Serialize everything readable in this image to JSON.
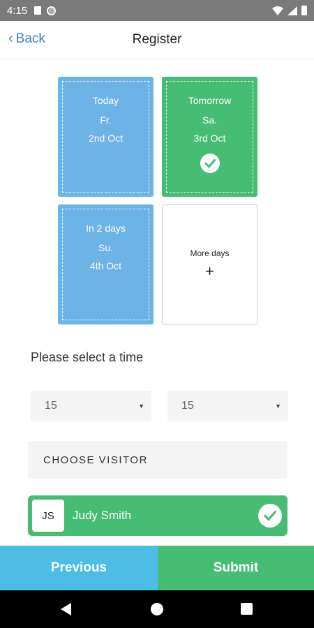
{
  "status_bar": {
    "time": "4:15"
  },
  "header": {
    "back_label": "Back",
    "title": "Register"
  },
  "days": [
    {
      "label": "Today",
      "weekday": "Fr.",
      "date": "2nd Oct",
      "selected": false,
      "color": "#6cb3e6"
    },
    {
      "label": "Tomorrow",
      "weekday": "Sa.",
      "date": "3rd Oct",
      "selected": true,
      "color": "#46bd73"
    },
    {
      "label": "In 2 days",
      "weekday": "Su.",
      "date": "4th Oct",
      "selected": false,
      "color": "#6cb3e6"
    }
  ],
  "more_days": {
    "label": "More days",
    "icon": "+"
  },
  "time_prompt": "Please select a time",
  "time": {
    "hour": "15",
    "minute": "15"
  },
  "choose_visitor_label": "CHOOSE VISITOR",
  "visitor": {
    "initials": "JS",
    "name": "Judy Smith",
    "selected": true
  },
  "footer": {
    "previous_label": "Previous",
    "submit_label": "Submit"
  },
  "colors": {
    "accent_green": "#46bd73",
    "accent_blue": "#6cb3e6",
    "previous_blue": "#4dbde6",
    "link_blue": "#3b82c4"
  }
}
